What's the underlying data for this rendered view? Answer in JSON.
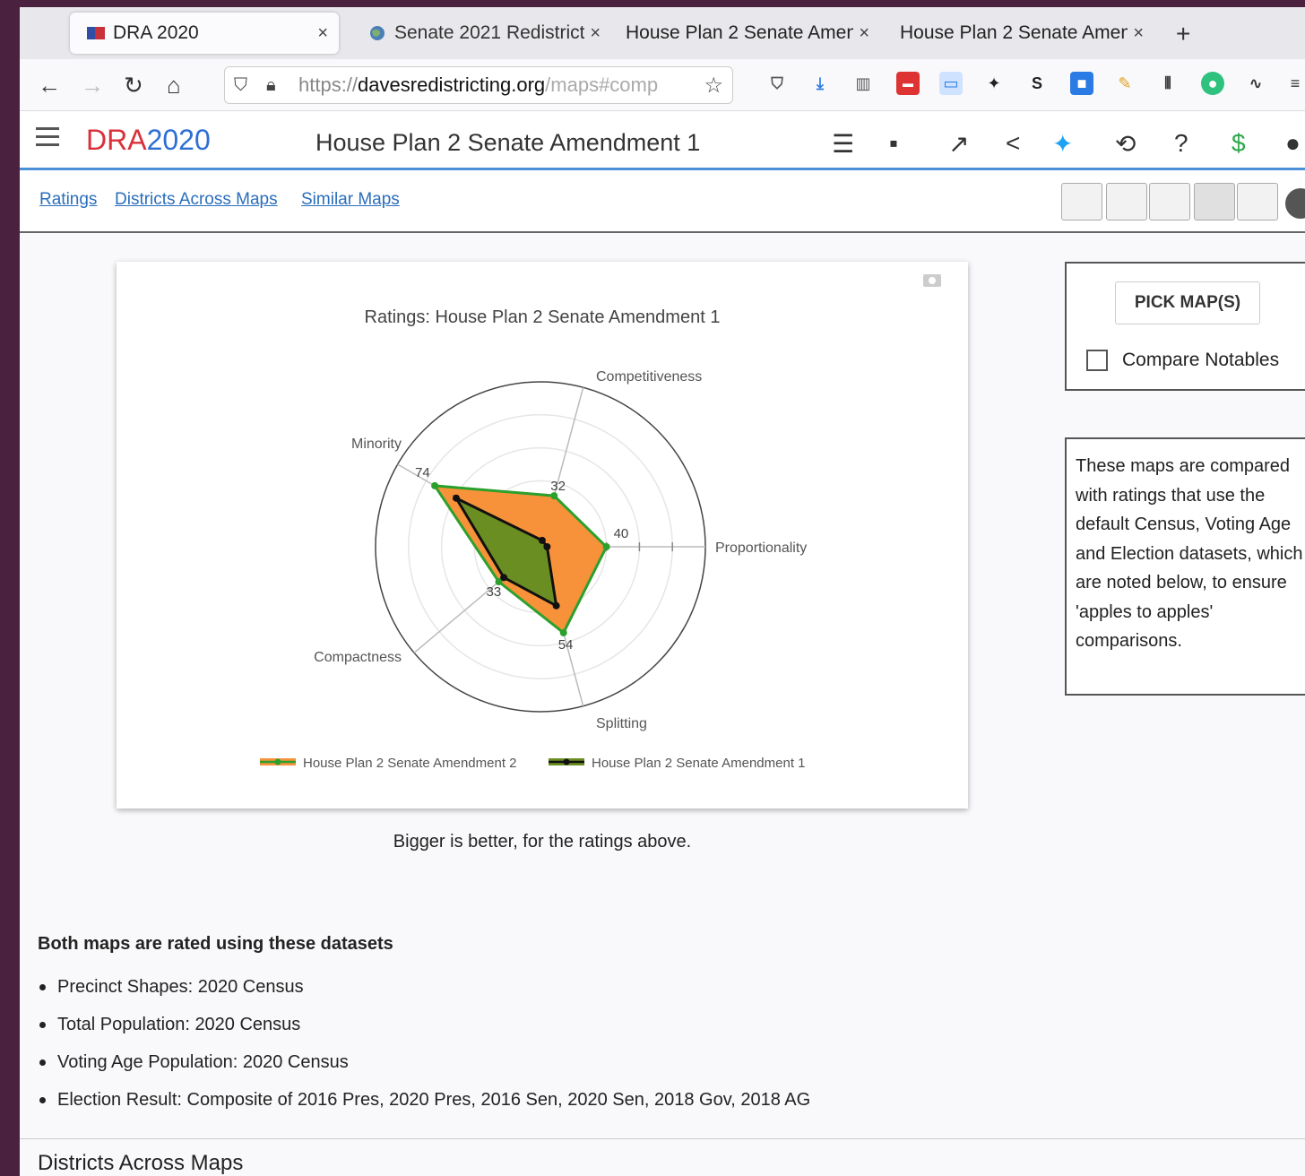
{
  "tabs": [
    {
      "title": "DRA 2020",
      "active": true
    },
    {
      "title": "Senate 2021 Redistricti",
      "active": false
    },
    {
      "title": "House Plan 2 Senate Amen",
      "active": false
    },
    {
      "title": "House Plan 2 Senate Amen",
      "active": false
    }
  ],
  "tab_close": "×",
  "new_tab": "+",
  "url": {
    "scheme": "https://",
    "host": "davesredistricting.org",
    "path": "/maps#comp"
  },
  "app": {
    "logo_a": "DRA",
    "logo_b": "2020",
    "map_title": "House Plan 2 Senate Amendment 1"
  },
  "subnav": {
    "links": [
      "Ratings",
      "Districts Across Maps",
      "Similar Maps"
    ]
  },
  "chart_data": {
    "type": "radar",
    "title": "Ratings: House Plan 2 Senate Amendment 1",
    "axes": [
      "Competitiveness",
      "Proportionality",
      "Splitting",
      "Compactness",
      "Minority"
    ],
    "rmax": 100,
    "series": [
      {
        "name": "House Plan 2 Senate Amendment 2",
        "values": [
          32,
          40,
          54,
          33,
          74
        ],
        "fill": "#f7923a",
        "line": "#2ca02c"
      },
      {
        "name": "House Plan 2 Senate Amendment 1",
        "values": [
          4,
          4,
          37,
          29,
          59
        ],
        "fill": "#6b8e23",
        "line": "#111111"
      }
    ],
    "value_labels": [
      {
        "axis": 0,
        "text": "32"
      },
      {
        "axis": 1,
        "text": "40"
      },
      {
        "axis": 2,
        "text": "54"
      },
      {
        "axis": 3,
        "text": "33"
      },
      {
        "axis": 4,
        "text": "74"
      }
    ],
    "legend": "bottom"
  },
  "caption": "Bigger is better, for the ratings above.",
  "pick": {
    "button": "PICK MAP(S)",
    "checkbox_label": "Compare Notables"
  },
  "note": "These maps are compared with ratings that use the default Census, Voting Age and Election datasets, which are noted below, to ensure 'apples to apples' comparisons.",
  "datasets": {
    "title": "Both maps are rated using these datasets",
    "items": [
      "Precinct Shapes: 2020 Census",
      "Total Population: 2020 Census",
      "Voting Age Population: 2020 Census",
      "Election Result: Composite of 2016 Pres, 2020 Pres, 2016 Sen, 2020 Sen, 2018 Gov, 2018 AG"
    ]
  },
  "next_section": "Districts Across Maps",
  "colors": {
    "accent": "#4a90d9",
    "link": "#2a6ebb",
    "logo_red": "#d9303a",
    "logo_blue": "#2e6fd4"
  }
}
